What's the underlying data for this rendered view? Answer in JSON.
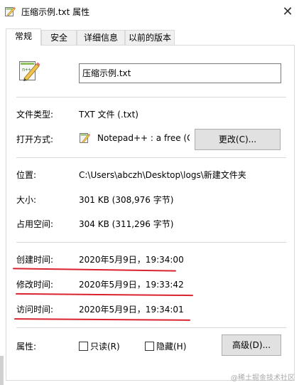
{
  "window": {
    "title": "压缩示例.txt 属性",
    "close": "✕"
  },
  "tabs": [
    {
      "label": "常规",
      "active": true
    },
    {
      "label": "安全",
      "active": false
    },
    {
      "label": "详细信息",
      "active": false
    },
    {
      "label": "以前的版本",
      "active": false
    }
  ],
  "general": {
    "file_name": "压缩示例.txt",
    "file_type_label": "文件类型:",
    "file_type_value": "TXT 文件 (.txt)",
    "opens_with_label": "打开方式:",
    "opens_with_value": "Notepad++ : a free (G",
    "change_button": "更改(C)...",
    "location_label": "位置:",
    "location_value": "C:\\Users\\abczh\\Desktop\\logs\\新建文件夹",
    "size_label": "大小:",
    "size_value": "301 KB (308,976 字节)",
    "size_on_disk_label": "占用空间:",
    "size_on_disk_value": "304 KB (311,296 字节)",
    "created_label": "创建时间:",
    "created_value": "2020年5月9日，19:34:00",
    "modified_label": "修改时间:",
    "modified_value": "2020年5月9日，19:33:42",
    "accessed_label": "访问时间:",
    "accessed_value": "2020年5月9日，19:34:01",
    "attributes_label": "属性:",
    "readonly_label": "只读(R)",
    "readonly_checked": false,
    "hidden_label": "隐藏(H)",
    "hidden_checked": false,
    "advanced_button": "高级(D)..."
  },
  "watermark": "@稀土掘金技术社区",
  "colors": {
    "annotation_red": "#d9232e",
    "button_face": "#e1e1e1",
    "border": "#d9d9d9"
  },
  "icons": {
    "file_icon": "notepadpp-file-icon",
    "close": "close-icon"
  }
}
